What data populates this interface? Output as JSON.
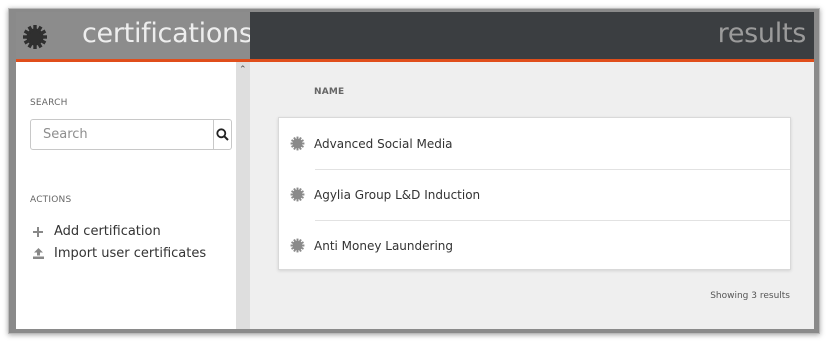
{
  "header": {
    "app_title": "certifications",
    "results_title": "results",
    "logo_icon": "badge-icon",
    "accent_color": "#e04e1b"
  },
  "sidebar": {
    "search_label": "SEARCH",
    "search_placeholder": "Search",
    "search_button_icon": "magnifier-icon",
    "actions_label": "ACTIONS",
    "actions": [
      {
        "label": "Add certification",
        "icon": "plus-icon"
      },
      {
        "label": "Import user certificates",
        "icon": "upload-icon"
      }
    ]
  },
  "main": {
    "column_header": "NAME",
    "rows": [
      {
        "name": "Advanced Social Media",
        "icon": "badge-icon"
      },
      {
        "name": "Agylia Group L&D Induction",
        "icon": "badge-icon"
      },
      {
        "name": "Anti Money Laundering",
        "icon": "badge-icon"
      }
    ],
    "showing_text": "Showing 3 results"
  }
}
